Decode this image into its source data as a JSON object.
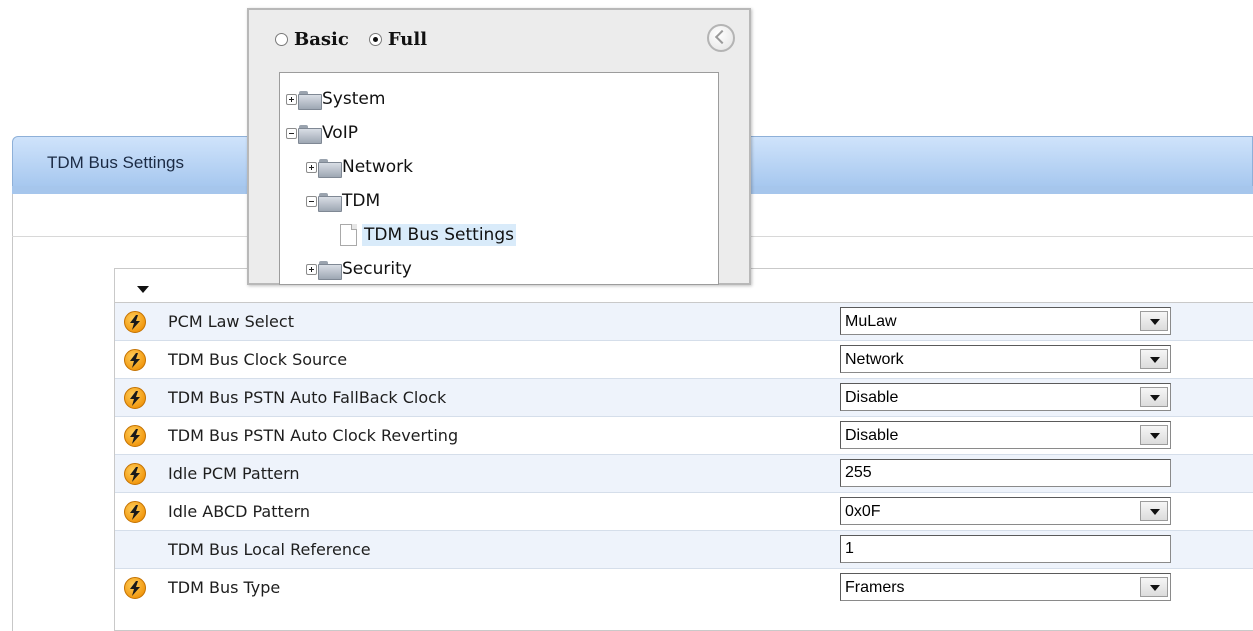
{
  "page_tab": {
    "title": "TDM Bus Settings"
  },
  "nav": {
    "modes": [
      {
        "label": "Basic",
        "checked": false
      },
      {
        "label": "Full",
        "checked": true
      }
    ],
    "tree": [
      {
        "label": "System",
        "expander": "plus",
        "icon": "folder-icon"
      },
      {
        "label": "VoIP",
        "expander": "minus",
        "icon": "folder-icon"
      },
      {
        "label": "Network",
        "expander": "plus",
        "icon": "folder-icon"
      },
      {
        "label": "TDM",
        "expander": "minus",
        "icon": "folder-icon"
      },
      {
        "label": "TDM Bus Settings",
        "expander": "none",
        "icon": "page-icon",
        "selected": true
      },
      {
        "label": "Security",
        "expander": "plus",
        "icon": "folder-icon"
      }
    ]
  },
  "params": [
    {
      "label": "PCM Law Select",
      "value": "MuLaw",
      "type": "select",
      "icon": "bolt-icon"
    },
    {
      "label": "TDM Bus Clock Source",
      "value": "Network",
      "type": "select",
      "icon": "bolt-icon"
    },
    {
      "label": "TDM Bus PSTN Auto FallBack Clock",
      "value": "Disable",
      "type": "select",
      "icon": "bolt-icon"
    },
    {
      "label": "TDM Bus PSTN Auto Clock Reverting",
      "value": "Disable",
      "type": "select",
      "icon": "bolt-icon"
    },
    {
      "label": "Idle PCM Pattern",
      "value": "255",
      "type": "text",
      "icon": "bolt-icon"
    },
    {
      "label": "Idle ABCD Pattern",
      "value": "0x0F",
      "type": "select",
      "icon": "bolt-icon"
    },
    {
      "label": "TDM Bus Local Reference",
      "value": "1",
      "type": "text",
      "icon": ""
    },
    {
      "label": "TDM Bus Type",
      "value": "Framers",
      "type": "select",
      "icon": "bolt-icon"
    }
  ],
  "colors": {
    "tab_gradient_top": "#cfe3fb",
    "tab_gradient_bottom": "#a7c8ef",
    "row_shade": "#eef3fb",
    "bolt_orange": "#f29a12",
    "selection_highlight": "#d9ebfa"
  }
}
